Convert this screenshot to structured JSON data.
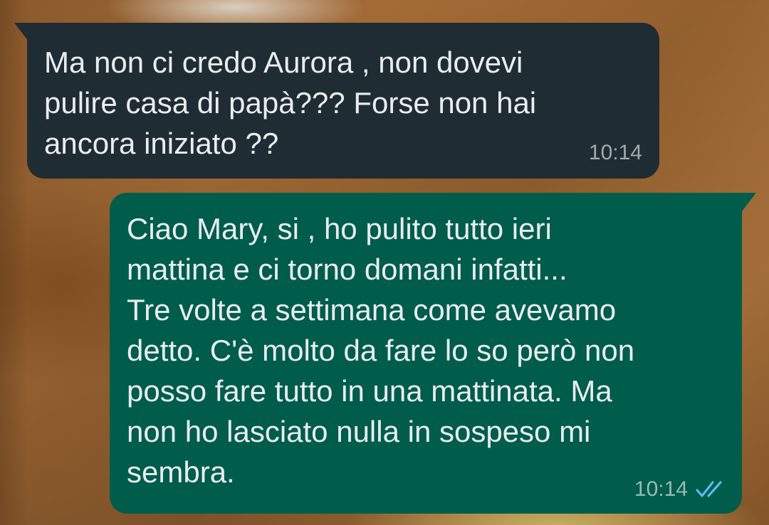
{
  "chat": {
    "messages": [
      {
        "direction": "incoming",
        "lines": [
          "Ma non ci credo Aurora , non dovevi",
          "pulire casa di papà??? Forse non hai",
          "ancora iniziato ??"
        ],
        "time": "10:14"
      },
      {
        "direction": "outgoing",
        "lines": [
          "Ciao Mary, si , ho pulito tutto ieri",
          "mattina e ci torno domani infatti...",
          "Tre volte a settimana come avevamo",
          "detto. C'è molto da fare lo so però non",
          "posso fare tutto in una mattinata. Ma",
          "non ho lasciato nulla in sospeso mi",
          "sembra."
        ],
        "time": "10:14",
        "status_icon": "double-check-icon",
        "status": "read"
      }
    ]
  },
  "colors": {
    "incoming_bubble": "#1f2c34",
    "outgoing_bubble": "#005c4b",
    "text": "#e9edef",
    "read_ticks": "#53bdeb"
  }
}
